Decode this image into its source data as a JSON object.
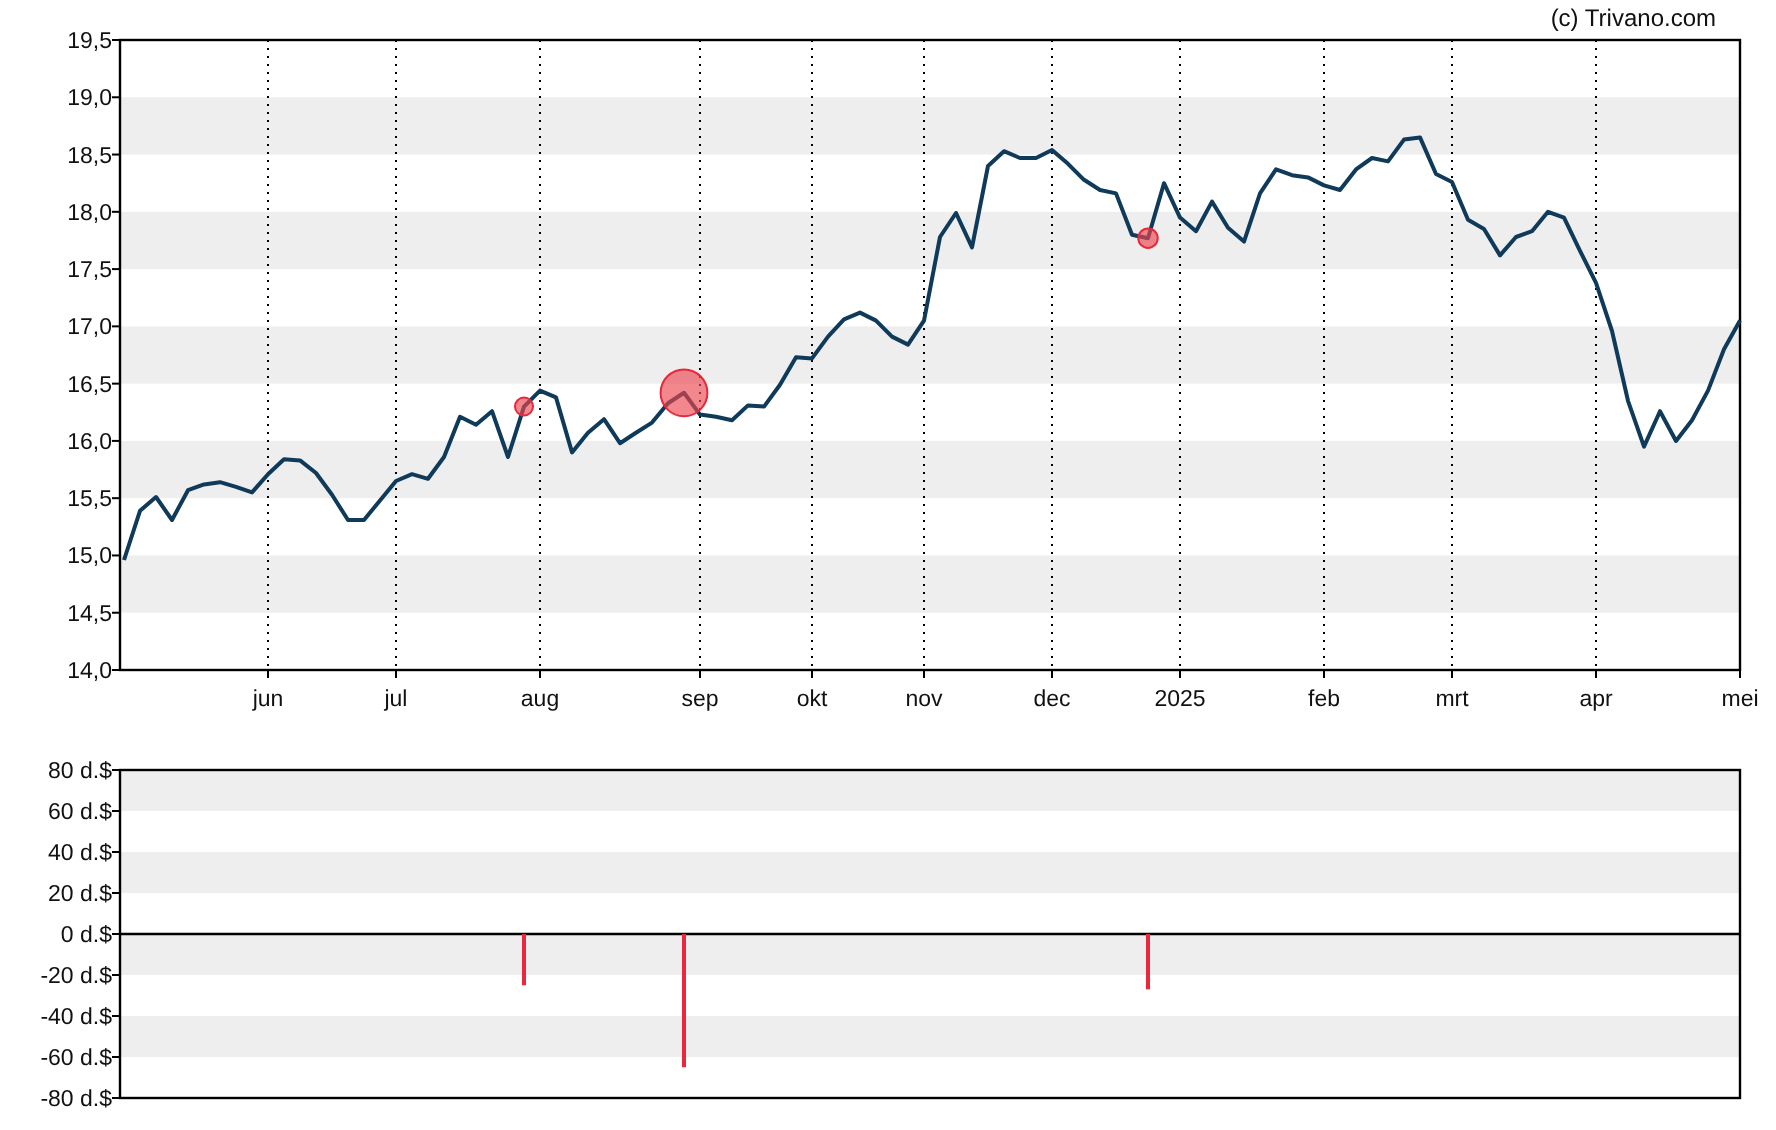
{
  "copyright": "(c) Trivano.com",
  "price_chart": {
    "chart_data": {
      "type": "line",
      "ylim": [
        14,
        19.5
      ],
      "categories": [
        null,
        null,
        null,
        null,
        null,
        null,
        null,
        null,
        null,
        "jun",
        null,
        null,
        null,
        null,
        null,
        null,
        null,
        "jul",
        null,
        null,
        null,
        null,
        null,
        null,
        null,
        null,
        "aug",
        null,
        null,
        null,
        null,
        null,
        null,
        null,
        null,
        null,
        "sep",
        null,
        null,
        null,
        null,
        null,
        null,
        "okt",
        null,
        null,
        null,
        null,
        null,
        null,
        "nov",
        null,
        null,
        null,
        null,
        null,
        null,
        null,
        "dec",
        null,
        null,
        null,
        null,
        null,
        null,
        null,
        "2025",
        null,
        null,
        null,
        null,
        null,
        null,
        null,
        null,
        "feb",
        null,
        null,
        null,
        null,
        null,
        null,
        null,
        "mrt",
        null,
        null,
        null,
        null,
        null,
        null,
        null,
        null,
        "apr",
        null,
        null,
        null,
        null,
        null,
        null,
        null,
        null,
        "mei"
      ],
      "series": [
        {
          "color": "#0f3a5a",
          "values": [
            14.96,
            15.39,
            15.51,
            15.31,
            15.57,
            15.62,
            15.64,
            15.6,
            15.55,
            15.71,
            15.84,
            15.83,
            15.72,
            15.53,
            15.31,
            15.31,
            15.48,
            15.65,
            15.71,
            15.67,
            15.86,
            16.21,
            16.14,
            16.26,
            15.86,
            16.3,
            16.44,
            16.38,
            15.9,
            16.07,
            16.19,
            15.98,
            16.07,
            16.16,
            16.33,
            16.42,
            16.23,
            16.21,
            16.18,
            16.31,
            16.3,
            16.49,
            16.73,
            16.72,
            16.91,
            17.06,
            17.12,
            17.05,
            16.91,
            16.84,
            17.05,
            17.78,
            17.99,
            17.69,
            18.4,
            18.53,
            18.47,
            18.47,
            18.54,
            18.42,
            18.28,
            18.19,
            18.16,
            17.8,
            17.77,
            18.25,
            17.95,
            17.83,
            18.09,
            17.86,
            17.74,
            18.16,
            18.37,
            18.32,
            18.3,
            18.23,
            18.19,
            18.37,
            18.47,
            18.44,
            18.63,
            18.65,
            18.33,
            18.26,
            17.93,
            17.85,
            17.62,
            17.78,
            17.83,
            18.0,
            17.95,
            17.66,
            17.38,
            16.96,
            16.35,
            15.95,
            16.26,
            16.0,
            16.18,
            16.44,
            16.8,
            17.05
          ]
        }
      ],
      "yticks": [
        {
          "value": 14,
          "label": "14,0"
        },
        {
          "value": 14.5,
          "label": "14,5"
        },
        {
          "value": 15,
          "label": "15,0"
        },
        {
          "value": 15.5,
          "label": "15,5"
        },
        {
          "value": 16,
          "label": "16,0"
        },
        {
          "value": 16.5,
          "label": "16,5"
        },
        {
          "value": 17,
          "label": "17,0"
        },
        {
          "value": 17.5,
          "label": "17,5"
        },
        {
          "value": 18,
          "label": "18,0"
        },
        {
          "value": 18.5,
          "label": "18,5"
        },
        {
          "value": 19,
          "label": "19,0"
        },
        {
          "value": 19.5,
          "label": "19,5"
        }
      ],
      "grid": true
    }
  },
  "dividend_chart": {
    "chart_data": {
      "type": "bar",
      "ylim": [
        -80,
        80
      ],
      "grid": true,
      "categories": [
        null,
        null,
        null,
        null,
        null,
        null,
        null,
        null,
        null,
        null,
        null,
        null,
        null,
        null,
        null,
        null,
        null,
        null,
        null,
        null,
        null,
        null,
        null,
        null,
        null,
        null,
        null,
        null,
        null,
        null,
        null,
        null,
        null,
        null,
        null,
        null,
        null,
        null,
        null,
        null,
        null,
        null,
        null,
        null,
        null,
        null,
        null,
        null,
        null,
        null,
        null,
        null,
        null,
        null,
        null,
        null,
        null,
        null,
        null,
        null,
        null,
        null,
        null,
        null,
        null,
        null,
        null,
        null,
        null,
        null,
        null,
        null,
        null,
        null,
        null,
        null,
        null,
        null,
        null,
        null,
        null,
        null,
        null,
        null,
        null,
        null,
        null,
        null,
        null,
        null,
        null,
        null,
        null,
        null,
        null,
        null,
        null,
        null,
        null,
        null,
        null,
        null
      ],
      "series": [
        {
          "color": "#e8283c",
          "values": [
            null,
            null,
            null,
            null,
            null,
            null,
            null,
            null,
            null,
            null,
            null,
            null,
            null,
            null,
            null,
            null,
            null,
            null,
            null,
            null,
            null,
            null,
            null,
            null,
            null,
            -25,
            null,
            null,
            null,
            null,
            null,
            null,
            null,
            null,
            null,
            -65,
            null,
            null,
            null,
            null,
            null,
            null,
            null,
            null,
            null,
            null,
            null,
            null,
            null,
            null,
            null,
            null,
            null,
            null,
            null,
            null,
            null,
            null,
            null,
            null,
            null,
            null,
            null,
            null,
            -27,
            null,
            null,
            null,
            null,
            null,
            null,
            null,
            null,
            null,
            null,
            null,
            null,
            null,
            null,
            null,
            null,
            null,
            null,
            null,
            null,
            null,
            null,
            null,
            null,
            null,
            null,
            null,
            null,
            null,
            null,
            null,
            null,
            null,
            null,
            null,
            null,
            null
          ]
        }
      ],
      "yticks": [
        {
          "value": 80,
          "label": "80 d.$"
        },
        {
          "value": 60,
          "label": "60 d.$"
        },
        {
          "value": 40,
          "label": "40 d.$"
        },
        {
          "value": 20,
          "label": "20 d.$"
        },
        {
          "value": 0,
          "label": "0 d.$"
        },
        {
          "value": -20,
          "label": "-20 d.$"
        },
        {
          "value": -40,
          "label": "-40 d.$"
        },
        {
          "value": -60,
          "label": "-60 d.$"
        },
        {
          "value": -80,
          "label": "-80 d.$"
        }
      ]
    }
  }
}
